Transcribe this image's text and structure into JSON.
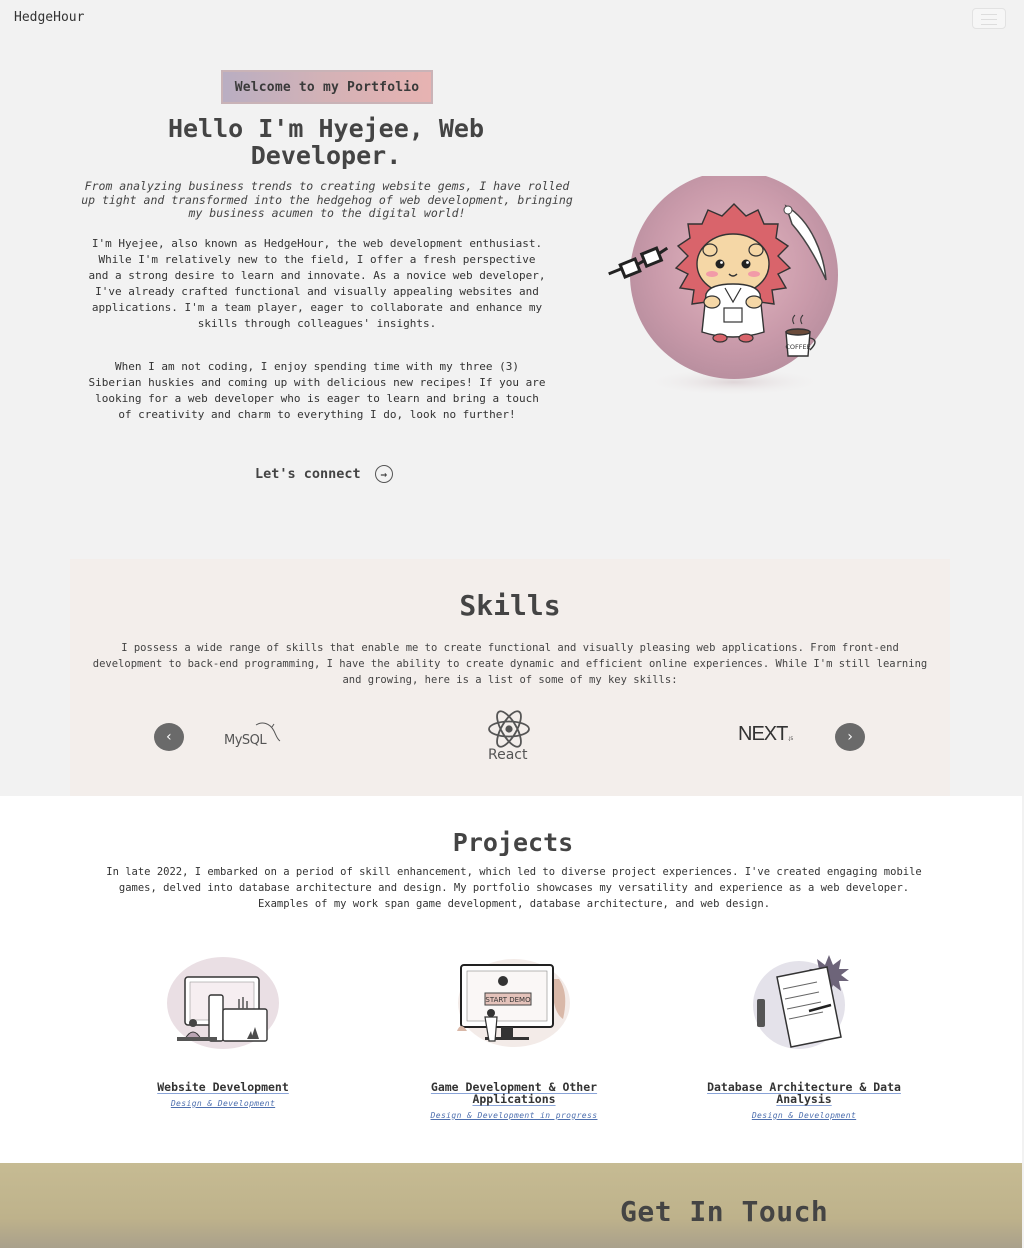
{
  "nav": {
    "brand": "HedgeHour"
  },
  "hero": {
    "badge": "Welcome to my Portfolio",
    "title": "Hello I'm Hyejee, Web Developer.",
    "subtitle": "From analyzing business trends to creating website gems, I have rolled up tight and transformed into the hedgehog of web development, bringing my business acumen to the digital world!",
    "paragraph1": "I'm Hyejee, also known as HedgeHour, the web development enthusiast. While I'm relatively new to the field, I offer a fresh perspective and a strong desire to learn and innovate. As a novice web developer, I've already crafted functional and visually appealing websites and applications. I'm a team player, eager to collaborate and enhance my skills through colleagues' insights.",
    "paragraph2": "When I am not coding, I enjoy spending time with my three (3) Siberian huskies and coming up with delicious new recipes! If you are looking for a web developer who is eager to learn and bring a touch of creativity and charm to everything I do, look no further!",
    "connect_label": "Let's connect",
    "image_text": "COFFEE"
  },
  "skills": {
    "title": "Skills",
    "description": "I possess a wide range of skills that enable me to create functional and visually pleasing web applications. From front-end development to back-end programming, I have the ability to create dynamic and efficient online experiences. While I'm still learning and growing, here is a list of some of my key skills:",
    "logos": [
      {
        "name": "MySQL"
      },
      {
        "name": "React"
      },
      {
        "name": "NEXT",
        "suffix": ".JS"
      }
    ]
  },
  "projects": {
    "title": "Projects",
    "description": "In late 2022, I embarked on a period of skill enhancement, which led to diverse project experiences. I've created engaging mobile games, delved into database architecture and design. My portfolio showcases my versatility and experience as a web developer. Examples of my work span game development, database architecture, and web design.",
    "items": [
      {
        "title": "Website Development",
        "tag": "Design & Development"
      },
      {
        "title": "Game Development & Other Applications",
        "tag": "Design & Development in progress",
        "image_text": "START DEMO"
      },
      {
        "title": "Database Architecture & Data Analysis",
        "tag": "Design & Development"
      }
    ]
  },
  "contact": {
    "title": "Get In Touch"
  }
}
